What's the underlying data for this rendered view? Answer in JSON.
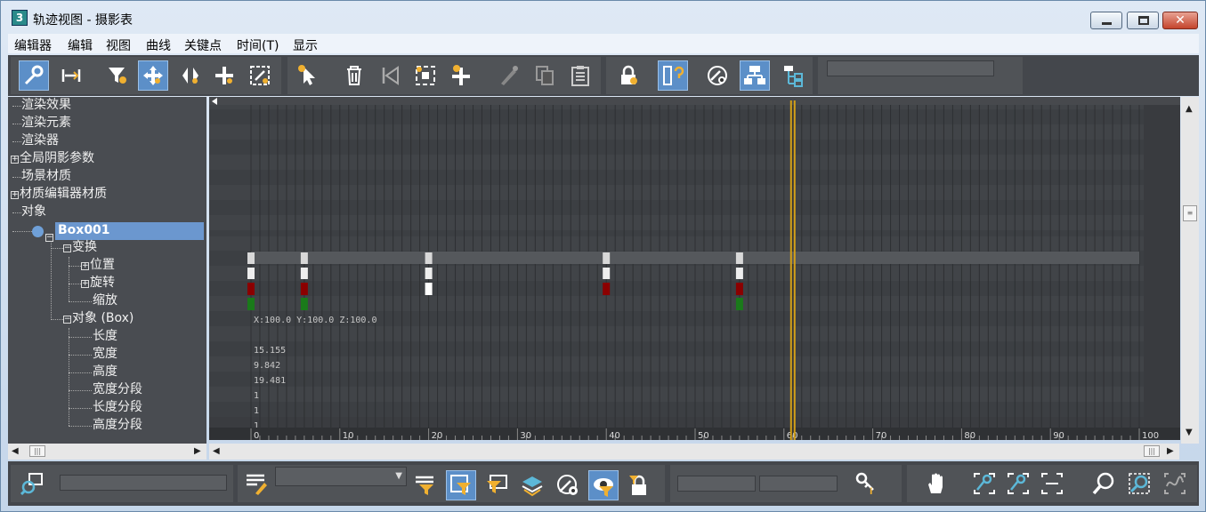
{
  "window": {
    "title": "轨迹视图 - 摄影表",
    "icon": "3ds-max-icon"
  },
  "menu": [
    "编辑器",
    "编辑",
    "视图",
    "曲线",
    "关键点",
    "时间(T)",
    "显示"
  ],
  "toolbar": {
    "icons": [
      "filter-keys-icon",
      "slide-keys-icon",
      "filter-icon",
      "move-keys-icon",
      "slide-keys-icon2",
      "add-keys-icon",
      "scale-keys-icon",
      "select-time-icon",
      "delete-time-icon",
      "reverse-time-icon",
      "scale-time-icon",
      "insert-time-icon",
      "soft-select-icon",
      "copy-icon",
      "paste-icon",
      "lock-selection-icon",
      "snap-frames-icon",
      "show-keyable-icon",
      "modify-subtree-icon",
      "modify-child-keys-icon"
    ]
  },
  "tree": {
    "items": [
      "渲染效果",
      "渲染元素",
      "渲染器",
      "全局阴影参数",
      "场景材质",
      "材质编辑器材质",
      "对象",
      "Box001",
      "变换",
      "位置",
      "旋转",
      "缩放",
      "对象 (Box)",
      "长度",
      "宽度",
      "高度",
      "宽度分段",
      "长度分段",
      "高度分段"
    ]
  },
  "dopesheet": {
    "transform_readout": "X:100.0 Y:100.0 Z:100.0",
    "values": [
      "15.155",
      "9.842",
      "19.481",
      "1",
      "1",
      "1"
    ],
    "ruler": [
      "0",
      "10",
      "20",
      "30",
      "40",
      "50",
      "60",
      "70",
      "80",
      "90",
      "100"
    ],
    "current_frame": 61,
    "keys_position": [
      0,
      6,
      20,
      40,
      55
    ],
    "keys_rotation": [
      0,
      6,
      40,
      55
    ],
    "keys_scale": [
      0,
      6,
      55
    ]
  },
  "colors": {
    "accent": "#6b97cf",
    "timeline_cursor": "#d4a017",
    "key_red": "#8b0000",
    "key_green": "#1a7a1a"
  }
}
